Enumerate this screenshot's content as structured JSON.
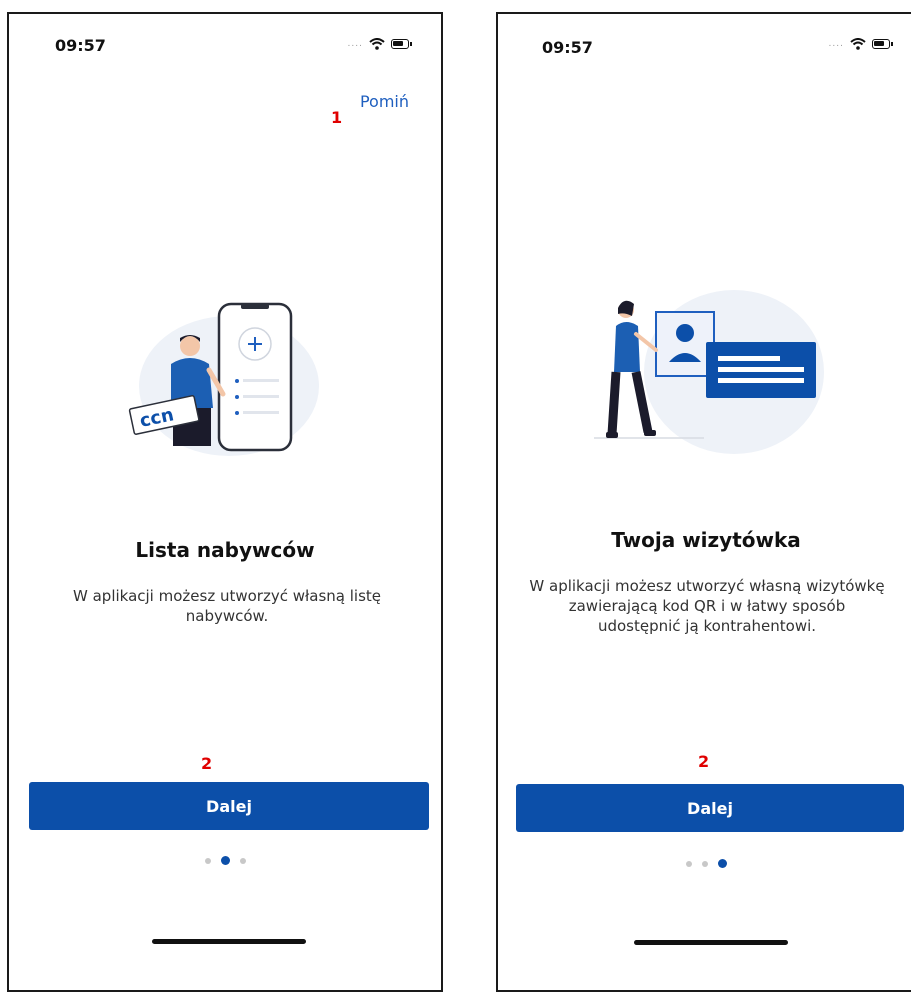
{
  "left": {
    "time": "09:57",
    "signal": "....",
    "skip_label": "Pomiń",
    "annotation_skip": "1",
    "title": "Lista nabywców",
    "description": "W aplikacji możesz utworzyć własną listę nabywców.",
    "annotation_button": "2",
    "button_label": "Dalej",
    "active_dot": 2
  },
  "right": {
    "time": "09:57",
    "signal": "....",
    "title": "Twoja wizytówka",
    "description": "W aplikacji możesz utworzyć własną wizytówkę zawierającą kod QR i w łatwy sposób udostępnić ją kontrahentowi.",
    "annotation_button": "2",
    "button_label": "Dalej",
    "active_dot": 3
  },
  "colors": {
    "accent": "#0c4fa9",
    "link": "#1f5fbf",
    "annotation": "#e00000"
  },
  "icons": [
    "wifi-icon",
    "battery-icon",
    "person-with-phone-illustration",
    "person-with-business-card-illustration"
  ]
}
